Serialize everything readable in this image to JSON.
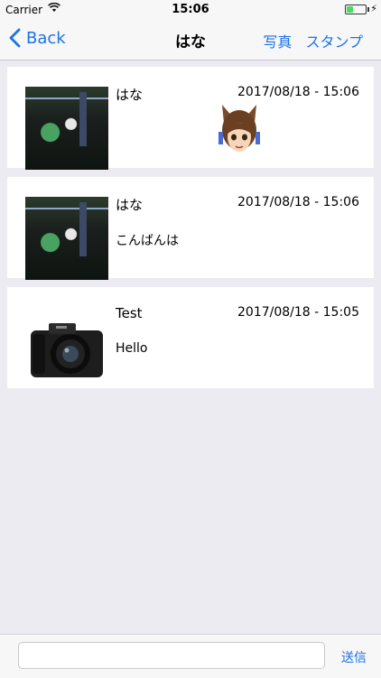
{
  "status_bar": {
    "carrier": "Carrier",
    "time": "15:06",
    "battery_level": 0.35
  },
  "nav": {
    "back_label": "Back",
    "title": "はな",
    "photo_label": "写真",
    "stamp_label": "スタンプ"
  },
  "messages": [
    {
      "sender": "はな",
      "timestamp": "2017/08/18 - 15:06",
      "text": "",
      "has_sticker": true
    },
    {
      "sender": "はな",
      "timestamp": "2017/08/18 - 15:06",
      "text": "こんばんは"
    },
    {
      "sender": "Test",
      "timestamp": "2017/08/18 - 15:05",
      "text": "Hello"
    }
  ],
  "composer": {
    "value": "",
    "placeholder": "",
    "send_label": "送信"
  },
  "colors": {
    "accent": "#1a73e8",
    "background": "#ebebf1",
    "battery": "#4cd964"
  }
}
